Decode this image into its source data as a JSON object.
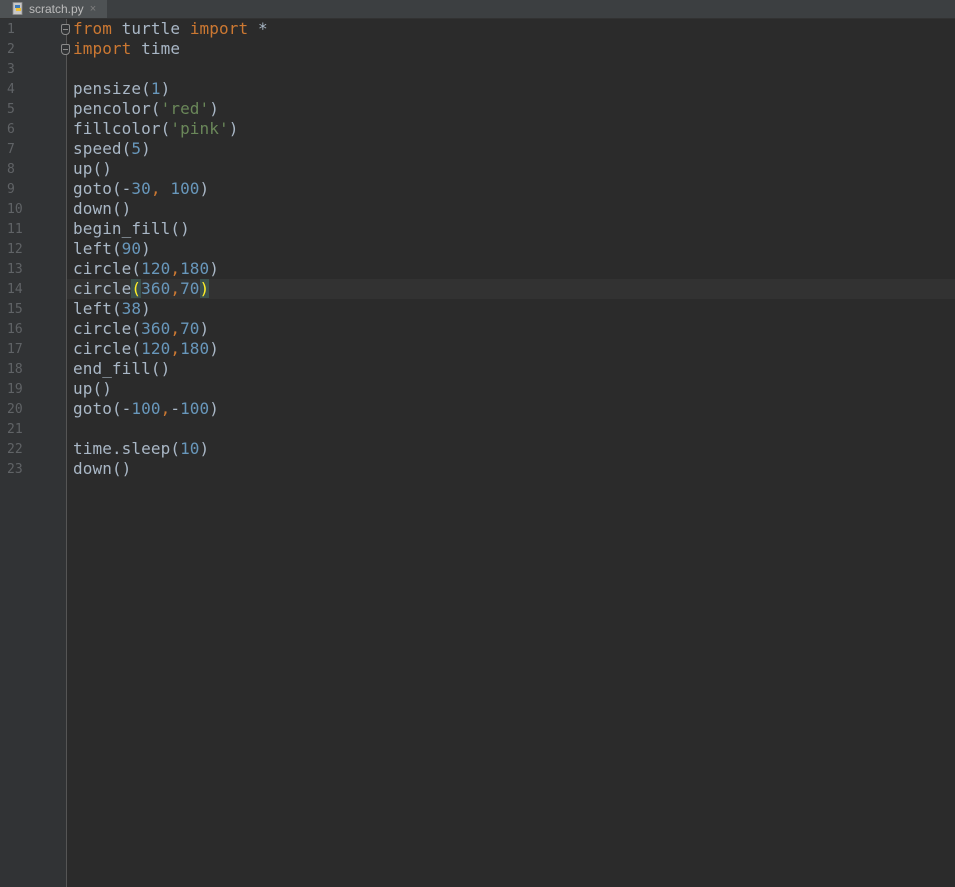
{
  "tab": {
    "label": "scratch.py",
    "close": "×"
  },
  "lines": [
    {
      "n": "1",
      "t": "from turtle import *"
    },
    {
      "n": "2",
      "t": "import time"
    },
    {
      "n": "3",
      "t": ""
    },
    {
      "n": "4",
      "t": "pensize(1)"
    },
    {
      "n": "5",
      "t": "pencolor('red')"
    },
    {
      "n": "6",
      "t": "fillcolor('pink')"
    },
    {
      "n": "7",
      "t": "speed(5)"
    },
    {
      "n": "8",
      "t": "up()"
    },
    {
      "n": "9",
      "t": "goto(-30, 100)"
    },
    {
      "n": "10",
      "t": "down()"
    },
    {
      "n": "11",
      "t": "begin_fill()"
    },
    {
      "n": "12",
      "t": "left(90)"
    },
    {
      "n": "13",
      "t": "circle(120,180)"
    },
    {
      "n": "14",
      "t": "circle(360,70)"
    },
    {
      "n": "15",
      "t": "left(38)"
    },
    {
      "n": "16",
      "t": "circle(360,70)"
    },
    {
      "n": "17",
      "t": "circle(120,180)"
    },
    {
      "n": "18",
      "t": "end_fill()"
    },
    {
      "n": "19",
      "t": "up()"
    },
    {
      "n": "20",
      "t": "goto(-100,-100)"
    },
    {
      "n": "21",
      "t": ""
    },
    {
      "n": "22",
      "t": "time.sleep(10)"
    },
    {
      "n": "23",
      "t": "down()"
    }
  ],
  "caret_line": "14",
  "colors": {
    "background": "#2b2b2b",
    "keyword": "#cc7832",
    "number": "#6897bb",
    "string": "#6a8759",
    "text": "#a9b7c6"
  }
}
